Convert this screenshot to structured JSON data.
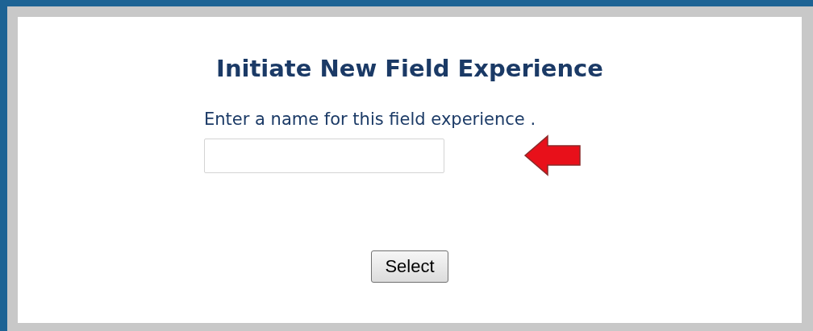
{
  "title": "Initiate New Field Experience",
  "name_field": {
    "label": "Enter a name for this field experience ."
  },
  "buttons": [
    "Select"
  ]
}
